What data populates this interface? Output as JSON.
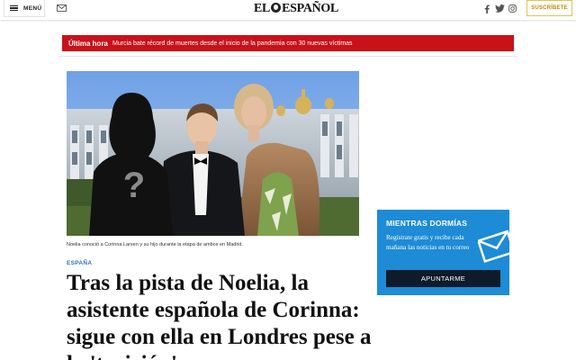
{
  "header": {
    "menu_label": "MENÚ",
    "logo_text_left": "EL",
    "logo_text_right": "ESPAÑOL",
    "subscribe_label": "SUSCRÍBETE",
    "icons": [
      "menu-icon",
      "mail-icon",
      "facebook-icon",
      "twitter-icon",
      "instagram-icon"
    ]
  },
  "breaking": {
    "tag": "Última hora",
    "text": "Murcia bate récord de muertes desde el inicio de la pandemia con 30 nuevas víctimas",
    "color": "#c9111a"
  },
  "article": {
    "caption": "Noelia conoció a Corinna Larsen y su hijo durante la etapa de ambos en Madrid.",
    "section": "ESPAÑA",
    "headline": "Tras la pista de Noelia, la asistente española de Corinna: sigue con ella en Londres pese a la 'traición'",
    "section_color": "#2a74c4"
  },
  "newsletter": {
    "title": "MIENTRAS DORMÍAS",
    "description": "Regístrate gratis y recibe cada mañana las noticias en tu correo",
    "button_label": "APUNTARME",
    "background": "#1e8bd6"
  }
}
